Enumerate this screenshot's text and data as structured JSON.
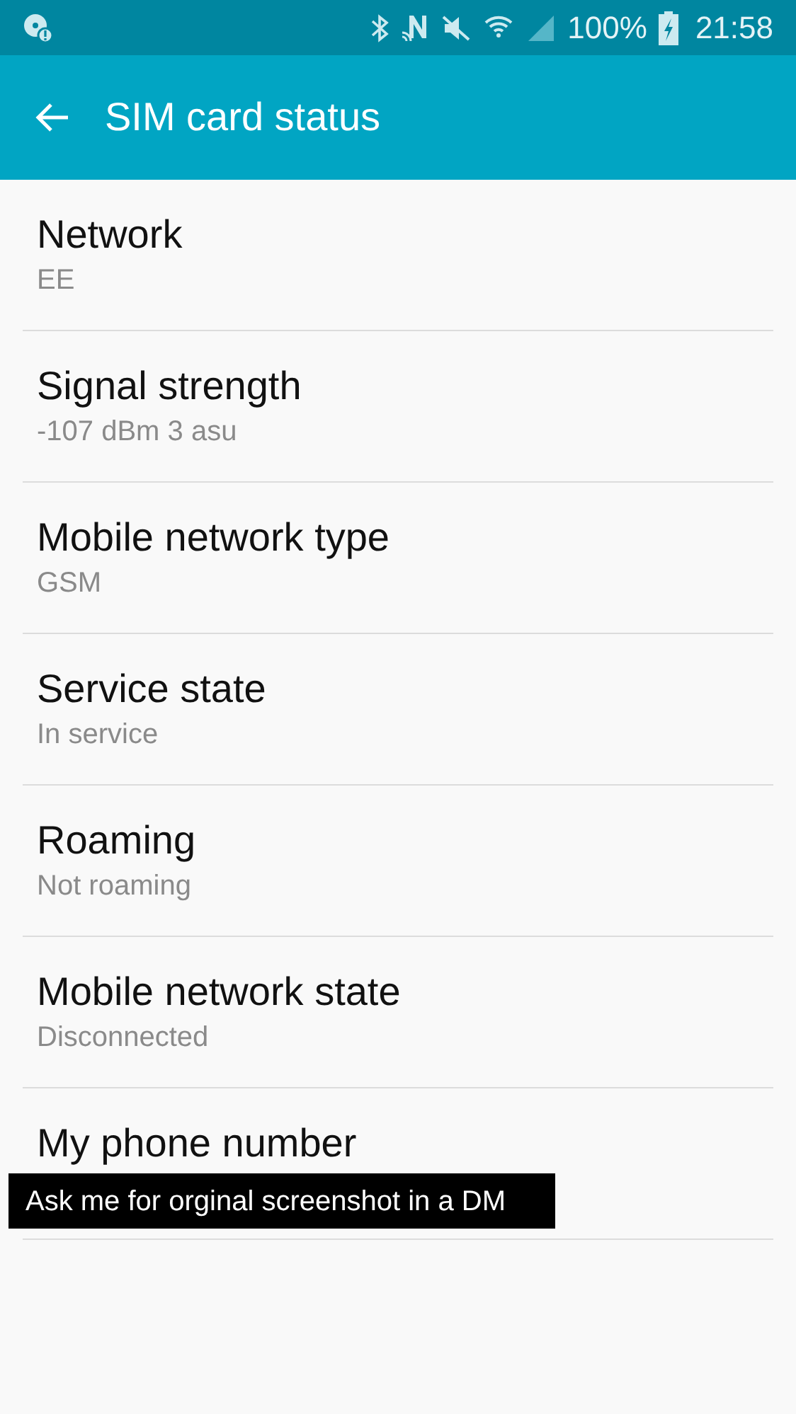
{
  "status_bar": {
    "battery": "100%",
    "time": "21:58"
  },
  "app_bar": {
    "title": "SIM card status"
  },
  "items": [
    {
      "label": "Network",
      "value": "EE"
    },
    {
      "label": "Signal strength",
      "value": "-107 dBm 3 asu"
    },
    {
      "label": "Mobile network type",
      "value": "GSM"
    },
    {
      "label": "Service state",
      "value": "In service"
    },
    {
      "label": "Roaming",
      "value": "Not roaming"
    },
    {
      "label": "Mobile network state",
      "value": "Disconnected"
    },
    {
      "label": "My phone number"
    }
  ],
  "overlay_note": "Ask me for orginal screenshot in a DM"
}
